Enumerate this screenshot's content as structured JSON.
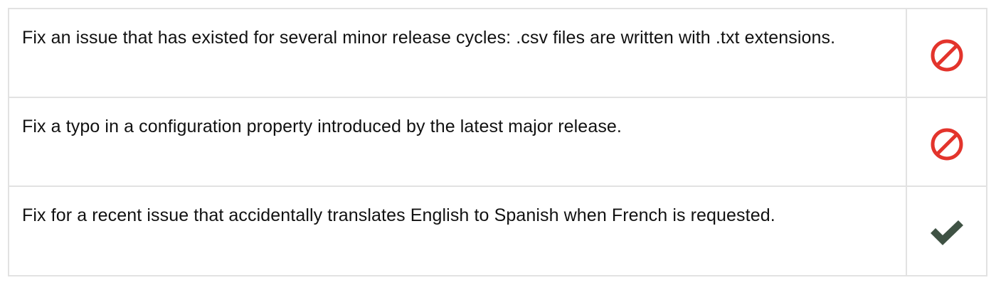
{
  "rows": [
    {
      "text": "Fix an issue that has existed for several minor release cycles: .csv files are written with .txt extensions.",
      "status_icon": "prohibited-icon",
      "status_color": "#e3342c"
    },
    {
      "text": "Fix a typo in a configuration property introduced by the latest major release.",
      "status_icon": "prohibited-icon",
      "status_color": "#e3342c"
    },
    {
      "text": "Fix for a recent issue that accidentally translates English to Spanish when French is requested.",
      "status_icon": "checkmark-icon",
      "status_color": "#3f5244"
    }
  ]
}
